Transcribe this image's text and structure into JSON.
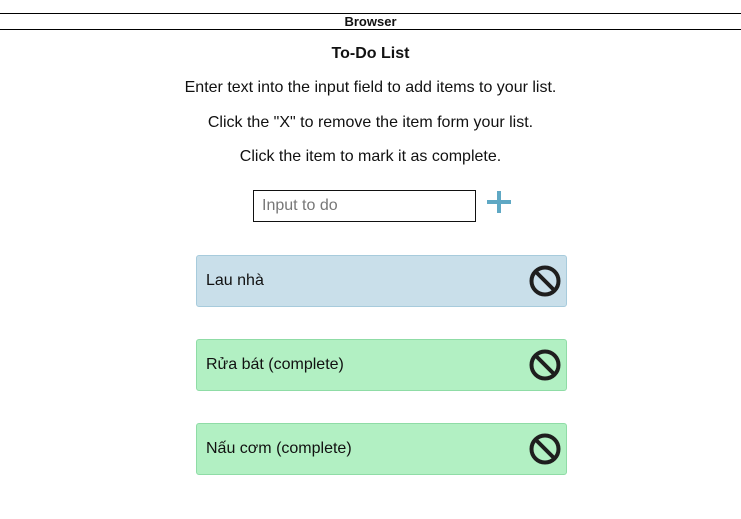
{
  "browser": {
    "title": "Browser"
  },
  "app": {
    "title": "To-Do List",
    "instructions": [
      "Enter text into the input field to add items to your list.",
      "Click the \"X\" to remove the item form your list.",
      "Click the item to mark it as complete."
    ],
    "input": {
      "placeholder": "Input to do",
      "value": ""
    },
    "add_icon": "plus-icon",
    "remove_icon": "remove-circle-icon",
    "colors": {
      "accent": "#5fa8c4",
      "item_active": "#c9dfea",
      "item_complete": "#b2f0c3"
    },
    "items": [
      {
        "label": "Lau nhà",
        "complete": false
      },
      {
        "label": "Rửa bát (complete)",
        "complete": true
      },
      {
        "label": "Nấu cơm (complete)",
        "complete": true
      }
    ]
  }
}
